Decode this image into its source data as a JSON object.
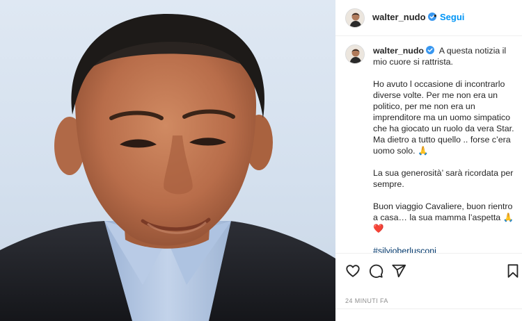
{
  "post": {
    "username": "walter_nudo",
    "follow_label": "Segui",
    "dot": "•",
    "caption_line1": "A questa notizia il mio cuore si rattrista.",
    "paragraph2": "Ho avuto l occasione di incontrarlo diverse volte. Per me non era un politico, per me non era un imprenditore ma un uomo simpatico che ha giocato un ruolo da vera Star. Ma dietro a tutto quello .. forse c’era uomo solo. 🙏",
    "paragraph3": "La sua generosità’ sarà ricordata per sempre.",
    "paragraph4": "Buon viaggio Cavaliere, buon rientro a casa… la sua mamma l’aspetta 🙏 ❤️",
    "hashtag": "#silvioberlusconi",
    "timestamp": "24 MINUTI FA"
  },
  "icons": {
    "verified": "verified-badge-icon",
    "like": "heart-icon",
    "comment": "comment-icon",
    "share": "paper-plane-icon",
    "save": "bookmark-icon"
  },
  "colors": {
    "link_blue": "#0095f6",
    "hashtag": "#00376b",
    "verified": "#3897f0",
    "muted": "#8e8e8e"
  }
}
